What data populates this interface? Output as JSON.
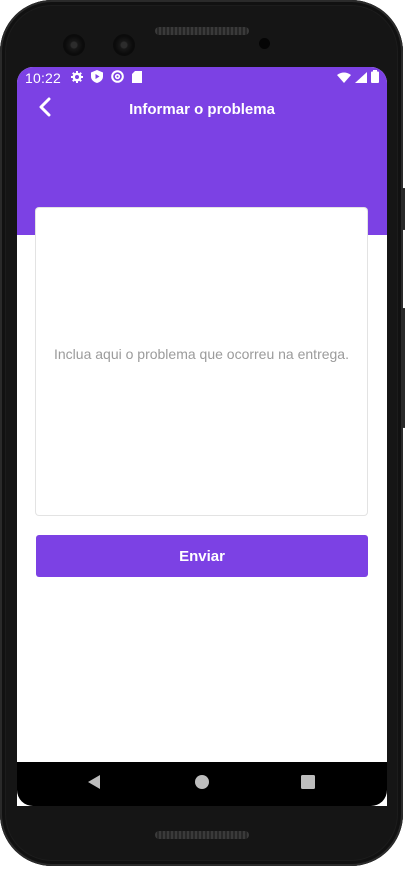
{
  "status_bar": {
    "time": "10:22",
    "left_icons": [
      "settings-icon",
      "play-protect-icon",
      "at-sign-icon",
      "sd-card-icon"
    ],
    "right_icons": [
      "wifi-icon",
      "signal-icon",
      "battery-icon"
    ]
  },
  "header": {
    "title": "Informar o problema",
    "back_icon": "chevron-left-icon"
  },
  "form": {
    "problem_placeholder": "Inclua aqui o problema que ocorreu na entrega.",
    "problem_value": "",
    "submit_label": "Enviar"
  },
  "navigation_bar": {
    "buttons": [
      "back-triangle-icon",
      "home-circle-icon",
      "recents-square-icon"
    ]
  },
  "colors": {
    "accent": "#7c41e4",
    "background": "#ffffff",
    "placeholder": "#9b9b9b"
  }
}
